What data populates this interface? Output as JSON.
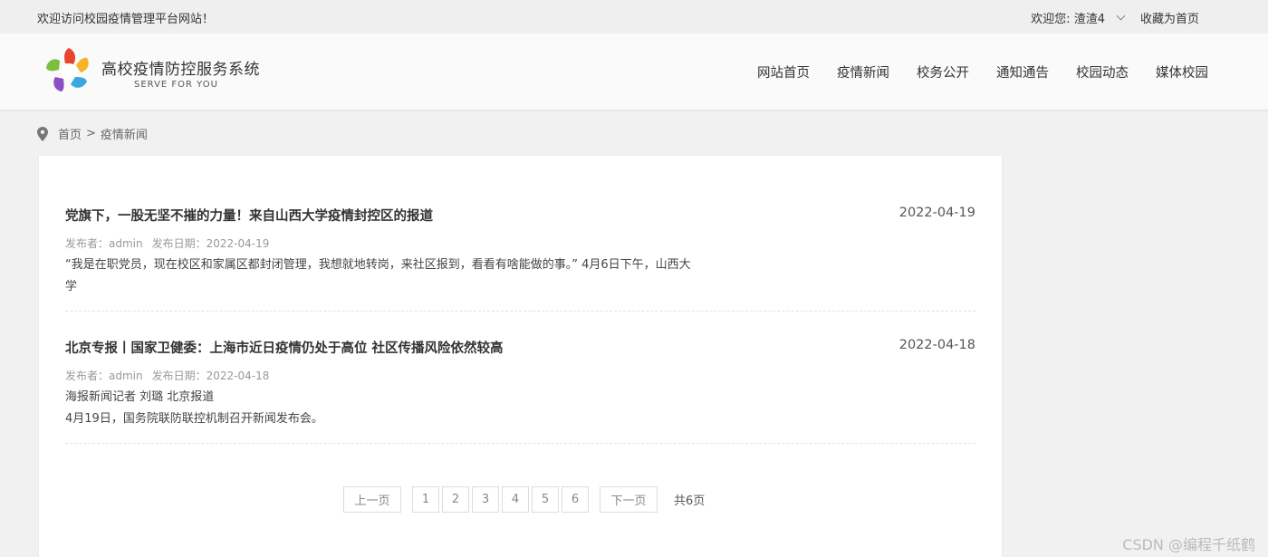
{
  "topbar": {
    "welcome": "欢迎访问校园疫情管理平台网站！",
    "user_greeting": "欢迎您: 渣渣4",
    "favorite": "收藏为首页"
  },
  "header": {
    "title": "高校疫情防控服务系统",
    "subtitle": "SERVE FOR YOU",
    "nav": [
      "网站首页",
      "疫情新闻",
      "校务公开",
      "通知通告",
      "校园动态",
      "媒体校园"
    ]
  },
  "breadcrumb": {
    "home": "首页",
    "separator": ">",
    "current": "疫情新闻"
  },
  "news": [
    {
      "title": "党旗下，一股无坚不摧的力量！来自山西大学疫情封控区的报道",
      "date": "2022-04-19",
      "author": "发布者：admin",
      "publish": "发布日期：2022-04-19",
      "excerpt": "“我是在职党员，现在校区和家属区都封闭管理，我想就地转岗，来社区报到，看看有啥能做的事。” 4月6日下午，山西大学"
    },
    {
      "title": "北京专报丨国家卫健委：上海市近日疫情仍处于高位 社区传播风险依然较高",
      "date": "2022-04-18",
      "author": "发布者：admin",
      "publish": "发布日期：2022-04-18",
      "excerpt_line1": "海报新闻记者 刘璐 北京报道",
      "excerpt_line2": "4月19日，国务院联防联控机制召开新闻发布会。"
    }
  ],
  "pagination": {
    "prev": "上一页",
    "pages": [
      "1",
      "2",
      "3",
      "4",
      "5",
      "6"
    ],
    "next": "下一页",
    "total": "共6页"
  },
  "watermark": "CSDN @编程千纸鹤",
  "colors": {
    "background": "#f1f1f1",
    "panel": "#ffffff",
    "text": "#333333"
  }
}
